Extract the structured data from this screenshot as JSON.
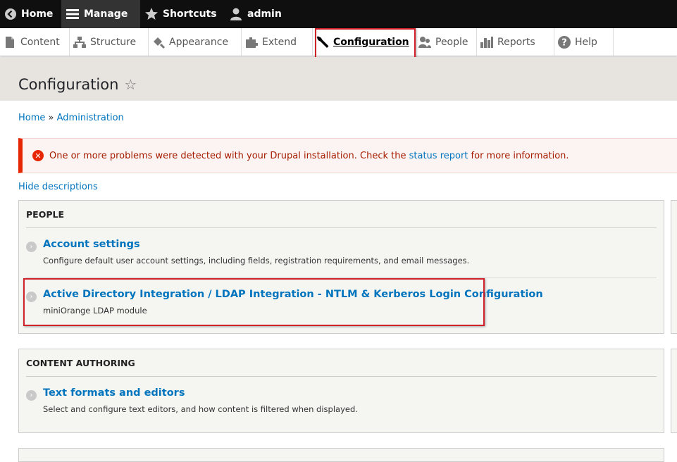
{
  "toolbar": {
    "home": "Home",
    "manage": "Manage",
    "shortcuts": "Shortcuts",
    "user": "admin"
  },
  "tray": {
    "items": [
      {
        "label": "Content",
        "icon": "content-icon"
      },
      {
        "label": "Structure",
        "icon": "structure-icon"
      },
      {
        "label": "Appearance",
        "icon": "appearance-icon"
      },
      {
        "label": "Extend",
        "icon": "extend-icon"
      },
      {
        "label": "Configuration",
        "icon": "wrench-icon",
        "active": true
      },
      {
        "label": "People",
        "icon": "people-icon"
      },
      {
        "label": "Reports",
        "icon": "reports-icon"
      },
      {
        "label": "Help",
        "icon": "help-icon"
      }
    ]
  },
  "page": {
    "title": "Configuration"
  },
  "breadcrumb": {
    "home": "Home",
    "separator": "»",
    "administration": "Administration"
  },
  "message": {
    "text_before": "One or more problems were detected with your Drupal installation. Check the",
    "link": "status report",
    "text_after": "for more information."
  },
  "hide_descriptions": "Hide descriptions",
  "sections": {
    "people": {
      "heading": "PEOPLE",
      "items": [
        {
          "title": "Account settings",
          "description": "Configure default user account settings, including fields, registration requirements, and email messages."
        },
        {
          "title": "Active Directory Integration / LDAP Integration - NTLM & Kerberos Login Configuration",
          "description": "miniOrange LDAP module"
        }
      ]
    },
    "content_authoring": {
      "heading": "CONTENT AUTHORING",
      "items": [
        {
          "title": "Text formats and editors",
          "description": "Select and configure text editors, and how content is filtered when displayed."
        }
      ]
    }
  },
  "colors": {
    "link": "#0074bd",
    "error": "#e62600",
    "highlight": "#d0202a",
    "toolbar": "#0f0f0f"
  }
}
